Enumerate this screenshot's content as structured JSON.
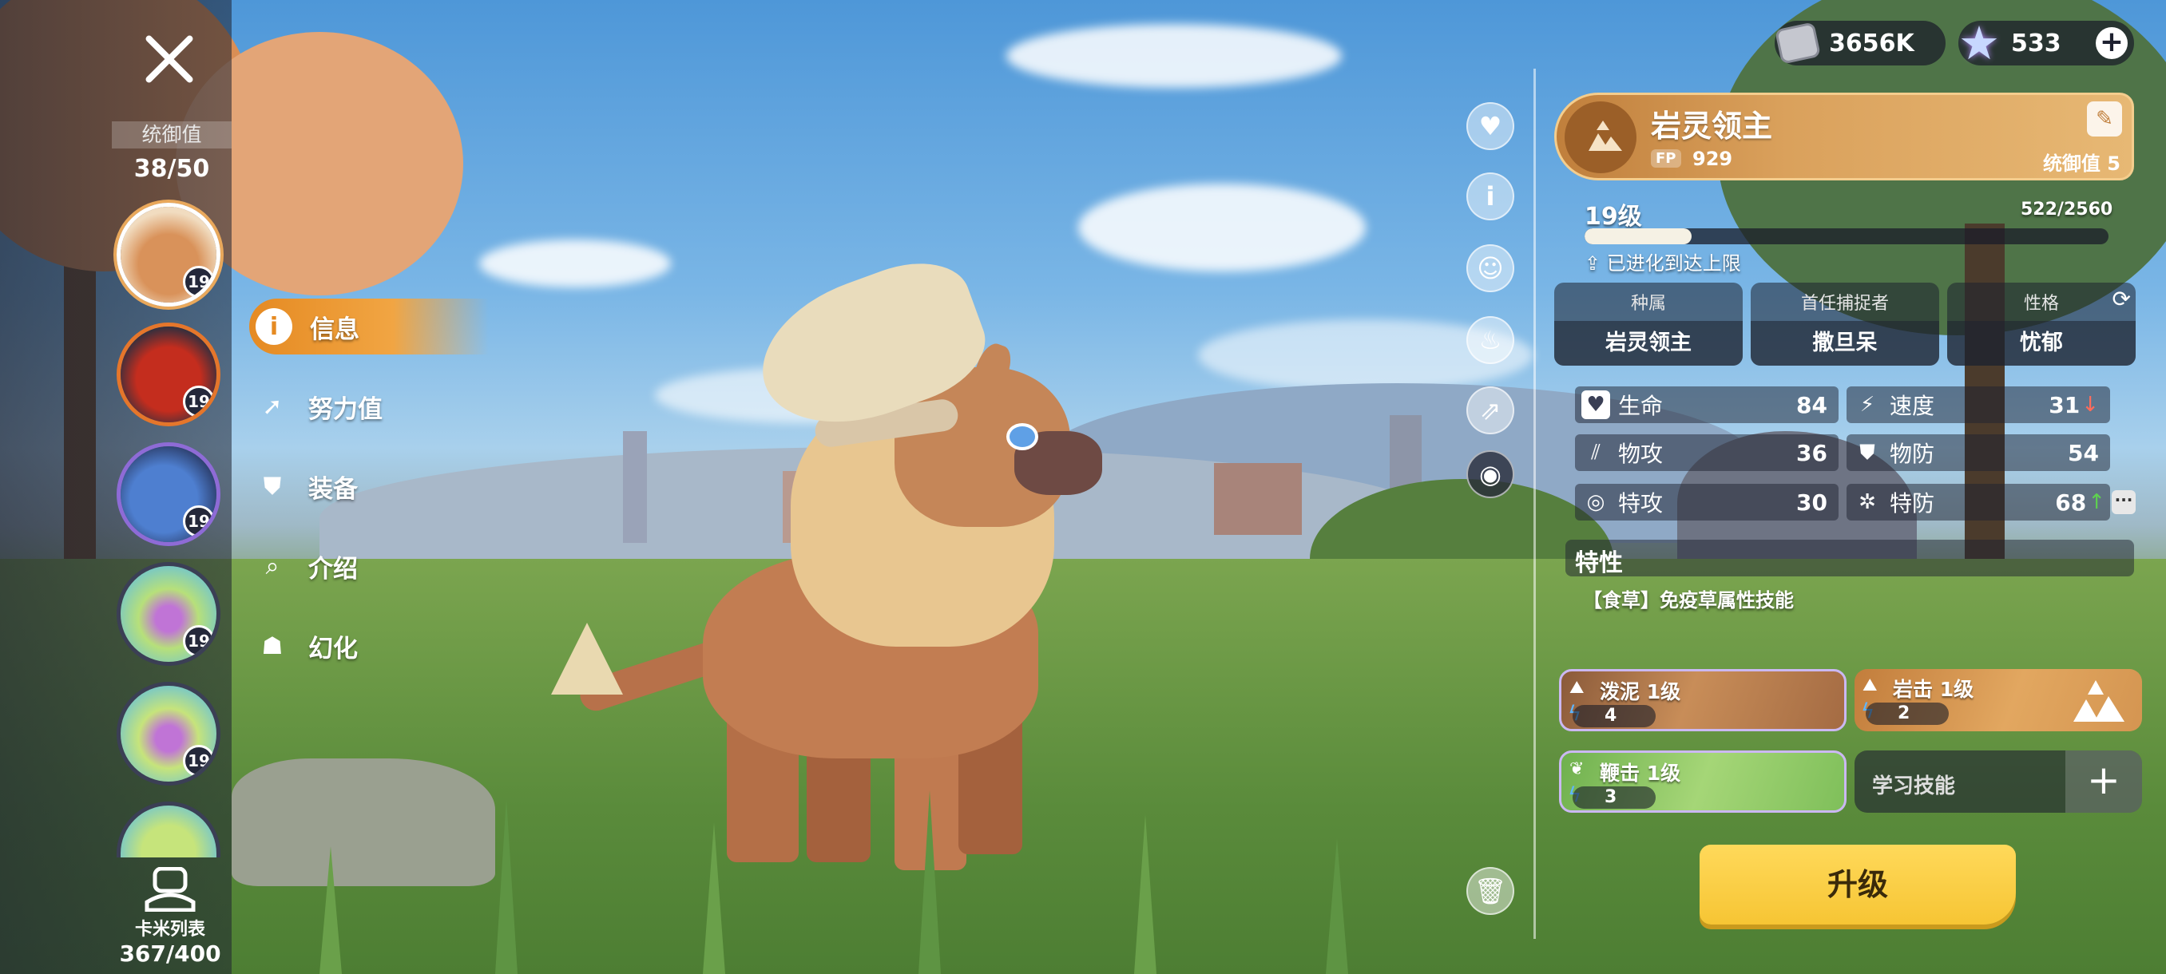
{
  "currencies": [
    {
      "icon": "gold-coin-icon",
      "value": "3656K"
    },
    {
      "icon": "star-crystal-icon",
      "value": "533"
    }
  ],
  "sidebar": {
    "control_label": "统御值",
    "control_value": "38/50",
    "pals": [
      {
        "name": "pal-avatar-1",
        "level": "19",
        "color": "#d9925a"
      },
      {
        "name": "pal-avatar-2",
        "level": "19",
        "color": "#c42d1e"
      },
      {
        "name": "pal-avatar-3",
        "level": "19",
        "color": "#4e7fd0"
      },
      {
        "name": "pal-avatar-4",
        "level": "19",
        "color": "#b7e07a"
      },
      {
        "name": "pal-avatar-5",
        "level": "19",
        "color": "#c6e47b"
      }
    ],
    "list_label": "卡米列表",
    "list_count": "367/400"
  },
  "menu": [
    {
      "label": "信息",
      "icon": "info-icon",
      "active": true
    },
    {
      "label": "努力值",
      "icon": "effort-icon",
      "active": false
    },
    {
      "label": "装备",
      "icon": "armor-icon",
      "active": false
    },
    {
      "label": "介绍",
      "icon": "book-search-icon",
      "active": false
    },
    {
      "label": "幻化",
      "icon": "ghost-icon",
      "active": false
    }
  ],
  "pal": {
    "name": "岩灵领主",
    "fp_label": "FP",
    "fp": "929",
    "control_cost": "统御值 5",
    "level": "19级",
    "exp": "522/2560",
    "exp_fraction": 0.204,
    "evolve_status": "已进化到达上限",
    "info": [
      {
        "label": "种属",
        "value": "岩灵领主"
      },
      {
        "label": "首任捕捉者",
        "value": "撒旦呆"
      },
      {
        "label": "性格",
        "value": "忧郁"
      }
    ],
    "stats": [
      {
        "name": "生命",
        "value": "84",
        "icon": "heart-icon"
      },
      {
        "name": "速度",
        "value": "31",
        "icon": "speed-icon",
        "trend": "down"
      },
      {
        "name": "物攻",
        "value": "36",
        "icon": "claw-icon"
      },
      {
        "name": "物防",
        "value": "54",
        "icon": "shield-icon"
      },
      {
        "name": "特攻",
        "value": "30",
        "icon": "spiral-icon"
      },
      {
        "name": "特防",
        "value": "68",
        "icon": "gear-icon",
        "trend": "up"
      }
    ],
    "trait_label": "特性",
    "trait_desc": "【食草】免疫草属性技能",
    "skills": [
      {
        "name": "泼泥 1级",
        "cost": "4",
        "element": "earth"
      },
      {
        "name": "岩击 1级",
        "cost": "2",
        "element": "rock"
      },
      {
        "name": "鞭击 1级",
        "cost": "3",
        "element": "grass"
      }
    ],
    "learn_label": "学习技能",
    "upgrade_label": "升级"
  },
  "colors": {
    "accent_orange": "#e58a22",
    "name_card": "#daa15c",
    "upgrade_yellow": "#f6c534",
    "stat_up": "#5ed14f",
    "stat_down": "#ff6b5b"
  }
}
